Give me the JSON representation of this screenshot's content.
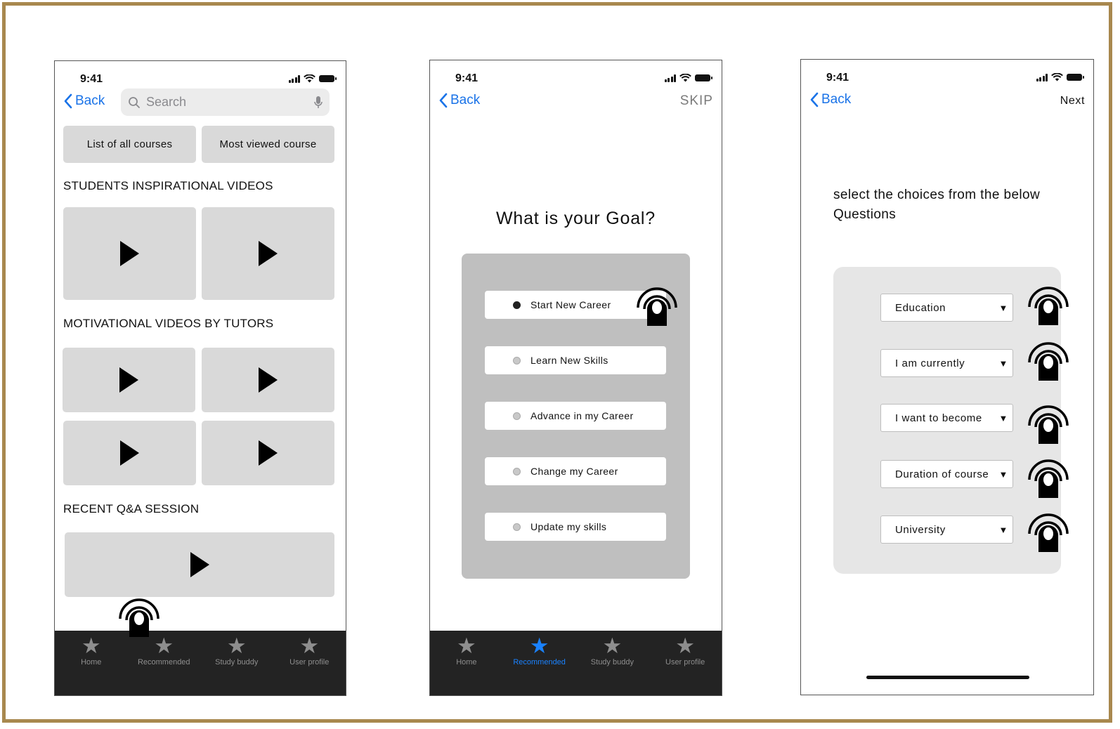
{
  "phone1": {
    "time": "9:41",
    "back_label": "Back",
    "search_placeholder": "Search",
    "pills": [
      "List of all courses",
      "Most viewed course"
    ],
    "sections": [
      "STUDENTS INSPIRATIONAL VIDEOS",
      "MOTIVATIONAL VIDEOS BY TUTORS",
      "RECENT Q&A SESSION"
    ],
    "tabs": [
      {
        "label": "Home"
      },
      {
        "label": "Recommended"
      },
      {
        "label": "Study buddy"
      },
      {
        "label": "User profile"
      }
    ]
  },
  "phone2": {
    "time": "9:41",
    "back_label": "Back",
    "skip_label": "SKIP",
    "title": "What is your Goal?",
    "options": [
      "Start New Career",
      "Learn New Skills",
      "Advance in my Career",
      "Change my Career",
      "Update my skills"
    ],
    "selected_option": "Start New Career",
    "tabs": [
      {
        "label": "Home"
      },
      {
        "label": "Recommended"
      },
      {
        "label": "Study buddy"
      },
      {
        "label": "User profile"
      }
    ],
    "active_tab": "Recommended"
  },
  "phone3": {
    "time": "9:41",
    "back_label": "Back",
    "next_label": "Next",
    "instruction": "select the choices from the below Questions",
    "selects": [
      "Education",
      "I am currently",
      "I want to become",
      "Duration of course",
      "University"
    ]
  },
  "colors": {
    "accent": "#1a82ff",
    "link": "#1a73e8",
    "frame_border": "#a8884e",
    "tabbar": "#232323"
  },
  "icons": [
    "star-icon",
    "chevron-left-icon",
    "search-icon",
    "mic-icon",
    "play-icon",
    "tap-gesture-icon",
    "wifi-icon",
    "signal-icon",
    "battery-icon"
  ]
}
